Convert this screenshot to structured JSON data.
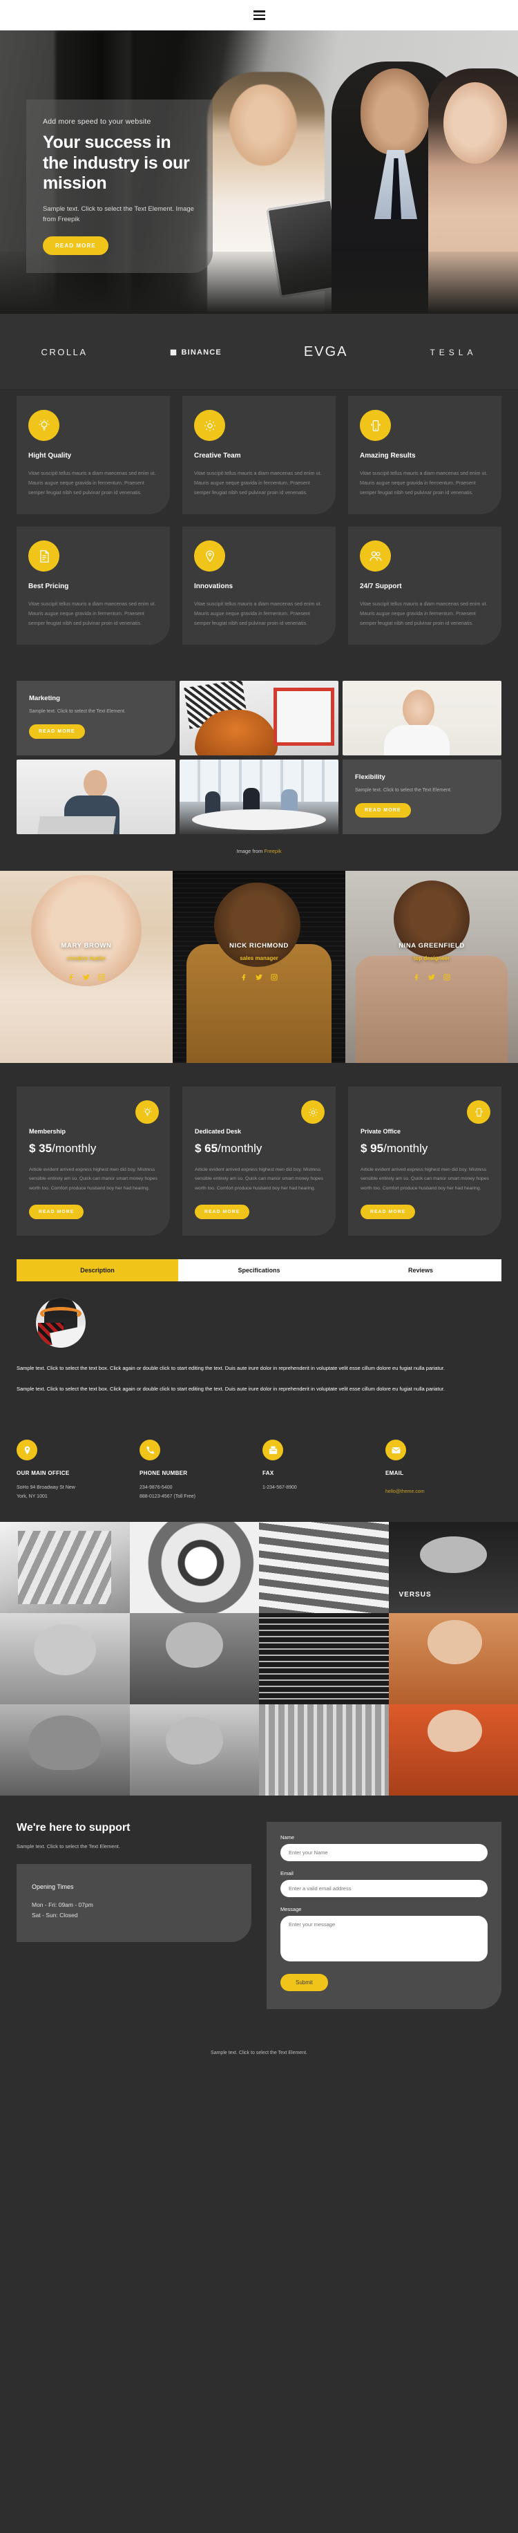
{
  "nav": {
    "menu_icon": "hamburger-menu-icon"
  },
  "hero": {
    "kicker": "Add more speed to your website",
    "title": "Your success in the industry is our mission",
    "subtitle": "Sample text. Click to select the Text Element. Image from Freepik",
    "cta": "READ MORE"
  },
  "brands": [
    {
      "name": "CROLLA"
    },
    {
      "name": "BINANCE"
    },
    {
      "name": "EVGA"
    },
    {
      "name": "TESLA"
    }
  ],
  "features": {
    "body": "Vitae suscipit tellus mauris a diam maecenas sed enim ut. Mauris augue neque gravida in fermentum. Praesent semper feugiat nibh sed pulvinar proin id venenatis.",
    "items": [
      {
        "title": "Hight Quality",
        "icon": "lightbulb-icon"
      },
      {
        "title": "Creative Team",
        "icon": "gear-icon"
      },
      {
        "title": "Amazing Results",
        "icon": "mobile-phone-icon"
      },
      {
        "title": "Best Pricing",
        "icon": "document-list-icon"
      },
      {
        "title": "Innovations",
        "icon": "map-pin-icon"
      },
      {
        "title": "24/7 Support",
        "icon": "users-icon"
      }
    ]
  },
  "gallery": {
    "marketing": {
      "title": "Marketing",
      "text": "Sample text. Click to select the Text Element.",
      "cta": "READ MORE"
    },
    "flexibility": {
      "title": "Flexibility",
      "text": "Sample text. Click to select the Text Element.",
      "cta": "READ MORE"
    },
    "credit_prefix": "Image from ",
    "credit_link": "Freepik"
  },
  "team": [
    {
      "name": "MARY BROWN",
      "role": "creative leader"
    },
    {
      "name": "NICK RICHMOND",
      "role": "sales manager"
    },
    {
      "name": "NINA GREENFIELD",
      "role": "top designeer"
    }
  ],
  "pricing": {
    "body": "Article evident arrived express highest men did boy. Mistress sensible entirely am so. Quick can manor smart money hopes worth too. Comfort produce husband boy her had hearing.",
    "cta": "READ MORE",
    "plans": [
      {
        "name": "Membership",
        "amount": "$ 35",
        "period": "/monthly",
        "icon": "lightbulb-icon"
      },
      {
        "name": "Dedicated Desk",
        "amount": "$ 65",
        "period": "/monthly",
        "icon": "gear-icon"
      },
      {
        "name": "Private Office",
        "amount": "$ 95",
        "period": "/monthly",
        "icon": "mobile-phone-icon"
      }
    ]
  },
  "tabs": {
    "items": [
      {
        "label": "Description",
        "active": true
      },
      {
        "label": "Specifications",
        "active": false
      },
      {
        "label": "Reviews",
        "active": false
      }
    ],
    "paragraph1": "Sample text. Click to select the text box. Click again or double click to start editing the text. Duis aute irure dolor in reprehenderit in voluptate velit esse cillum dolore eu fugiat nulla pariatur.",
    "paragraph2": "Sample text. Click to select the text box. Click again or double click to start editing the text. Duis aute irure dolor in reprehenderit in voluptate velit esse cillum dolore eu fugiat nulla pariatur."
  },
  "contact_info": [
    {
      "icon": "location-pin-icon",
      "title": "OUR MAIN OFFICE",
      "line1": "SoHo 94 Broadway St New",
      "line2": "York, NY 1001",
      "link": null
    },
    {
      "icon": "phone-icon",
      "title": "PHONE NUMBER",
      "line1": "234-9876-5400",
      "line2": "888-0123-4567 (Toll Free)",
      "link": null
    },
    {
      "icon": "fax-icon",
      "title": "FAX",
      "line1": "1-234-567-8900",
      "line2": "",
      "link": null
    },
    {
      "icon": "envelope-icon",
      "title": "EMAIL",
      "line1": "",
      "line2": "",
      "link": "hello@theme.com"
    }
  ],
  "mosaic_caption": "VERSUS",
  "support": {
    "title": "We're here to support",
    "subtitle": "Sample text. Click to select the Text Element.",
    "hours_title": "Opening Times",
    "hours_weekday": "Mon - Fri: 09am - 07pm",
    "hours_weekend": "Sat - Sun: Closed",
    "form": {
      "name_label": "Name",
      "name_placeholder": "Enter your Name",
      "email_label": "Email",
      "email_placeholder": "Enter a valid email address",
      "message_label": "Message",
      "message_placeholder": "Enter your message",
      "submit": "Submit"
    }
  },
  "footer": {
    "text": "Sample text. Click to select the Text Element."
  },
  "colors": {
    "accent": "#f0c419",
    "bg": "#2e2e2e",
    "card": "#3b3b3b",
    "card_light": "#4b4b4b"
  }
}
